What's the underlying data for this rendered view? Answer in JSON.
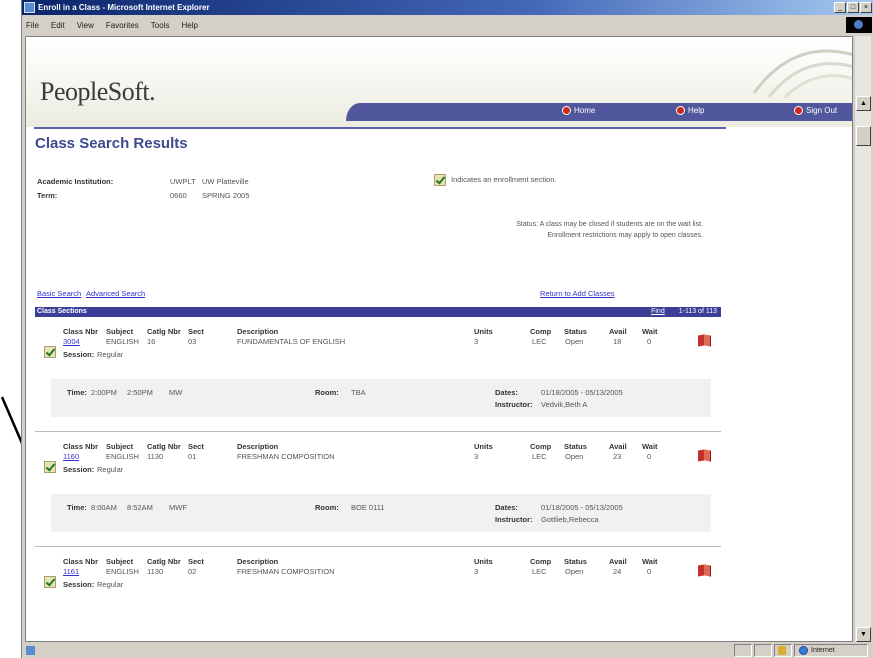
{
  "window": {
    "title": "Enroll in a Class - Microsoft Internet Explorer",
    "menu": [
      "File",
      "Edit",
      "View",
      "Favorites",
      "Tools",
      "Help"
    ]
  },
  "header": {
    "logo": "PeopleSoft.",
    "nav": {
      "home": "Home",
      "help": "Help",
      "signout": "Sign Out"
    }
  },
  "page": {
    "title": "Class Search Results",
    "academic_institution_label": "Academic Institution:",
    "academic_institution_code": "UWPLT",
    "academic_institution_name": "UW Platteville",
    "term_label": "Term:",
    "term_code": "0660",
    "term_name": "SPRING 2005",
    "legend": "Indicates an enrollment section.",
    "status_note_line1": "Status: A class may be closed if students are on the wait list.",
    "status_note_line2": "Enrollment restrictions may apply to open classes.",
    "basic_search": "Basic Search",
    "advanced_search": "Advanced Search",
    "return_link": "Return to Add Classes"
  },
  "sections": {
    "header_label": "Class Sections",
    "find_label": "Find",
    "count_label": "1-113 of 113",
    "column_labels": {
      "class_nbr": "Class Nbr",
      "subject": "Subject",
      "catlg": "Catlg Nbr",
      "sect": "Sect",
      "desc": "Description",
      "units": "Units",
      "comp": "Comp",
      "status": "Status",
      "avail": "Avail",
      "wait": "Wait",
      "session": "Session:",
      "time": "Time:",
      "room": "Room:",
      "dates": "Dates:",
      "instructor": "Instructor:"
    },
    "rows": [
      {
        "class_nbr": "3004",
        "subject": "ENGLISH",
        "catlg": "16",
        "sect": "03",
        "description": "FUNDAMENTALS OF ENGLISH",
        "units": "3",
        "comp": "LEC",
        "status": "Open",
        "avail": "18",
        "wait": "0",
        "session": "Regular",
        "time_start": "2:00PM",
        "time_end": "2:50PM",
        "days": "MW",
        "room": "TBA",
        "dates": "01/18/2005 - 05/13/2005",
        "instructor": "Vedvik,Beth A"
      },
      {
        "class_nbr": "1160",
        "subject": "ENGLISH",
        "catlg": "1130",
        "sect": "01",
        "description": "FRESHMAN COMPOSITION",
        "units": "3",
        "comp": "LEC",
        "status": "Open",
        "avail": "23",
        "wait": "0",
        "session": "Regular",
        "time_start": "8:00AM",
        "time_end": "8:52AM",
        "days": "MWF",
        "room": "BOE 0111",
        "dates": "01/18/2005 - 05/13/2005",
        "instructor": "Gottlieb,Rebecca"
      },
      {
        "class_nbr": "1161",
        "subject": "ENGLISH",
        "catlg": "1130",
        "sect": "02",
        "description": "FRESHMAN COMPOSITION",
        "units": "3",
        "comp": "LEC",
        "status": "Open",
        "avail": "24",
        "wait": "0",
        "session": "Regular"
      }
    ]
  },
  "statusbar": {
    "zone": "Internet"
  },
  "colors": {
    "nav_bar": "#51579c",
    "section_header": "#3b3f98",
    "title": "#3d4a8e",
    "link": "#3333cc"
  }
}
